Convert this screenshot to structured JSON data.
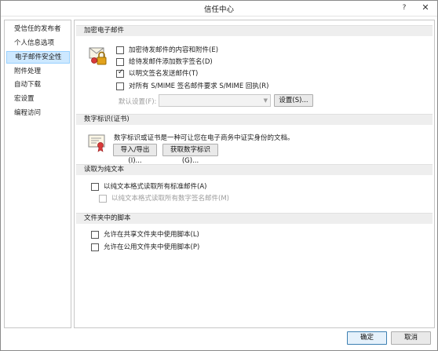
{
  "window": {
    "title": "信任中心",
    "help_glyph": "?",
    "close_glyph": "✕"
  },
  "sidebar": {
    "items": [
      {
        "label": "受信任的发布者",
        "selected": false
      },
      {
        "label": "个人信息选项",
        "selected": false
      },
      {
        "label": "电子邮件安全性",
        "selected": true
      },
      {
        "label": "附件处理",
        "selected": false
      },
      {
        "label": "自动下载",
        "selected": false
      },
      {
        "label": "宏设置",
        "selected": false
      },
      {
        "label": "编程访问",
        "selected": false
      }
    ]
  },
  "sections": {
    "encrypted_email": {
      "header": "加密电子邮件",
      "options": [
        {
          "label": "加密待发邮件的内容和附件(E)",
          "checked": false,
          "disabled": false
        },
        {
          "label": "给待发邮件添加数字签名(D)",
          "checked": false,
          "disabled": false
        },
        {
          "label": "以明文签名发送邮件(T)",
          "checked": true,
          "disabled": false
        },
        {
          "label": "对所有 S/MIME 签名邮件要求 S/MIME 回执(R)",
          "checked": false,
          "disabled": false
        }
      ],
      "default_setting_label": "默认设置(F):",
      "default_setting_value": "",
      "settings_button": "设置(S)..."
    },
    "digital_ids": {
      "header": "数字标识(证书)",
      "description": "数字标识或证书是一种可让您在电子商务中证实身份的文档。",
      "import_export_button": "导入/导出(I)...",
      "get_digital_id_button": "获取数字标识(G)..."
    },
    "plain_text": {
      "header": "读取为纯文本",
      "options": [
        {
          "label": "以纯文本格式读取所有标准邮件(A)",
          "checked": false,
          "disabled": false
        },
        {
          "label": "以纯文本格式读取所有数字签名邮件(M)",
          "checked": false,
          "disabled": true
        }
      ]
    },
    "folder_scripts": {
      "header": "文件夹中的脚本",
      "options": [
        {
          "label": "允许在共享文件夹中使用脚本(L)",
          "checked": false,
          "disabled": false
        },
        {
          "label": "允许在公用文件夹中使用脚本(P)",
          "checked": false,
          "disabled": false
        }
      ]
    }
  },
  "footer": {
    "ok_label": "确定",
    "cancel_label": "取消"
  },
  "icons": {
    "encryption": "lock-envelope-icon",
    "certificate": "certificate-icon"
  },
  "colors": {
    "selection_bg": "#cde8ff",
    "selection_border": "#99d1ff",
    "section_header_bg": "#eeeeee"
  }
}
